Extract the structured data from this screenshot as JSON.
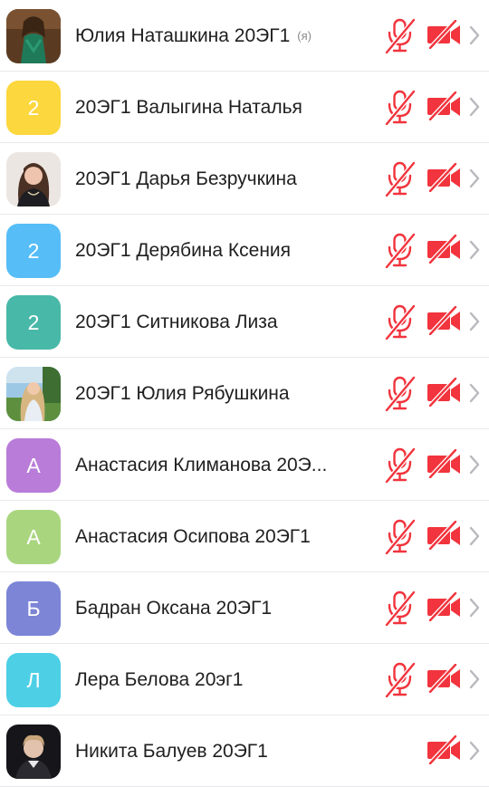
{
  "participants": [
    {
      "name": "Юлия Наташкина 20ЭГ1",
      "self_tag": "(я)",
      "avatar": {
        "kind": "photo",
        "icon": "photo-woman-green-dress"
      },
      "mic_muted": true,
      "cam_off": true
    },
    {
      "name": "20ЭГ1 Валыгина Наталья",
      "avatar": {
        "kind": "letter",
        "letter": "2",
        "color": "#FCD73D"
      },
      "mic_muted": true,
      "cam_off": true
    },
    {
      "name": "20ЭГ1 Дарья Безручкина",
      "avatar": {
        "kind": "photo",
        "icon": "photo-woman-portrait"
      },
      "mic_muted": true,
      "cam_off": true
    },
    {
      "name": "20ЭГ1 Дерябина Ксения",
      "avatar": {
        "kind": "letter",
        "letter": "2",
        "color": "#56BDF7"
      },
      "mic_muted": true,
      "cam_off": true
    },
    {
      "name": "20ЭГ1 Ситникова Лиза",
      "avatar": {
        "kind": "letter",
        "letter": "2",
        "color": "#48B8A8"
      },
      "mic_muted": true,
      "cam_off": true
    },
    {
      "name": "20ЭГ1 Юлия Рябушкина",
      "avatar": {
        "kind": "photo",
        "icon": "photo-woman-outdoors"
      },
      "mic_muted": true,
      "cam_off": true
    },
    {
      "name": "Анастасия Климанова 20Э...",
      "avatar": {
        "kind": "letter",
        "letter": "А",
        "color": "#B97CD8"
      },
      "mic_muted": true,
      "cam_off": true
    },
    {
      "name": "Анастасия Осипова 20ЭГ1",
      "avatar": {
        "kind": "letter",
        "letter": "А",
        "color": "#A9D57F"
      },
      "mic_muted": true,
      "cam_off": true
    },
    {
      "name": "Бадран Оксана 20ЭГ1",
      "avatar": {
        "kind": "letter",
        "letter": "Б",
        "color": "#7C85D6"
      },
      "mic_muted": true,
      "cam_off": true
    },
    {
      "name": "Лера Белова 20эг1",
      "avatar": {
        "kind": "letter",
        "letter": "Л",
        "color": "#4DCFE6"
      },
      "mic_muted": true,
      "cam_off": true
    },
    {
      "name": "Никита Балуев 20ЭГ1",
      "avatar": {
        "kind": "photo",
        "icon": "photo-man-portrait"
      },
      "mic_muted": false,
      "cam_off": true
    }
  ],
  "colors": {
    "muted_red": "#F1343D",
    "chevron": "#B8B8BE",
    "divider": "#E9E9EC"
  }
}
